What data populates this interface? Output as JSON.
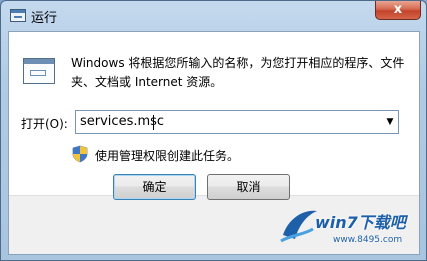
{
  "window": {
    "title": "运行",
    "close_glyph": "x"
  },
  "dialog": {
    "description": "Windows 将根据您所输入的名称，为您打开相应的程序、文件夹、文档或 Internet 资源。",
    "open_label": "打开(O):",
    "open_value": "services.msc",
    "dropdown_glyph": "▼",
    "admin_note": "使用管理权限创建此任务。"
  },
  "buttons": {
    "ok": "确定",
    "cancel": "取消"
  },
  "watermark": {
    "text": "win7下载吧",
    "url": "www.8495.com"
  },
  "colors": {
    "title_bar": "#b2cbe4",
    "close_button": "#c3432a",
    "footer": "#f0f0f0",
    "watermark": "#1d5fa8"
  }
}
